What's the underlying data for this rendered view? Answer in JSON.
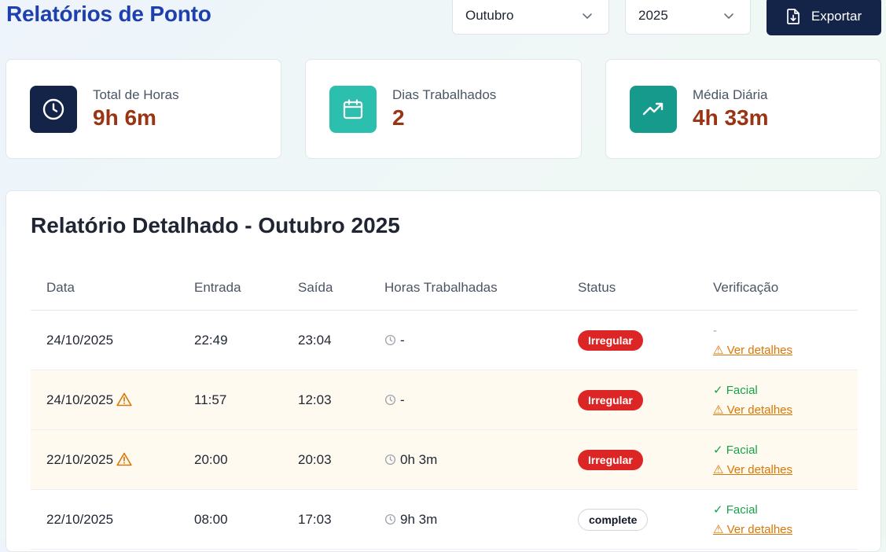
{
  "header": {
    "title": "Relatórios de Ponto",
    "month_select": "Outubro",
    "year_select": "2025",
    "export_label": "Exportar"
  },
  "stats": [
    {
      "label": "Total de Horas",
      "value": "9h 6m",
      "icon": "clock-icon",
      "color": "#132448"
    },
    {
      "label": "Dias Trabalhados",
      "value": "2",
      "icon": "calendar-icon",
      "color": "#2dbfae"
    },
    {
      "label": "Média Diária",
      "value": "4h 33m",
      "icon": "trending-up-icon",
      "color": "#159a8c"
    }
  ],
  "report": {
    "title": "Relatório Detalhado - Outubro 2025",
    "columns": [
      "Data",
      "Entrada",
      "Saída",
      "Horas Trabalhadas",
      "Status",
      "Verificação"
    ],
    "rows": [
      {
        "date": "24/10/2025",
        "warn": false,
        "in": "22:49",
        "out": "23:04",
        "hours": "-",
        "status": "Irregular",
        "verif": "-",
        "details": "⚠ Ver detalhes"
      },
      {
        "date": "24/10/2025",
        "warn": true,
        "in": "11:57",
        "out": "12:03",
        "hours": "-",
        "status": "Irregular",
        "verif": "✓ Facial",
        "details": "⚠ Ver detalhes"
      },
      {
        "date": "22/10/2025",
        "warn": true,
        "in": "20:00",
        "out": "20:03",
        "hours": "0h 3m",
        "status": "Irregular",
        "verif": "✓ Facial",
        "details": "⚠ Ver detalhes"
      },
      {
        "date": "22/10/2025",
        "warn": false,
        "in": "08:00",
        "out": "17:03",
        "hours": "9h 3m",
        "status": "complete",
        "verif": "✓ Facial",
        "details": "⚠ Ver detalhes"
      }
    ]
  }
}
